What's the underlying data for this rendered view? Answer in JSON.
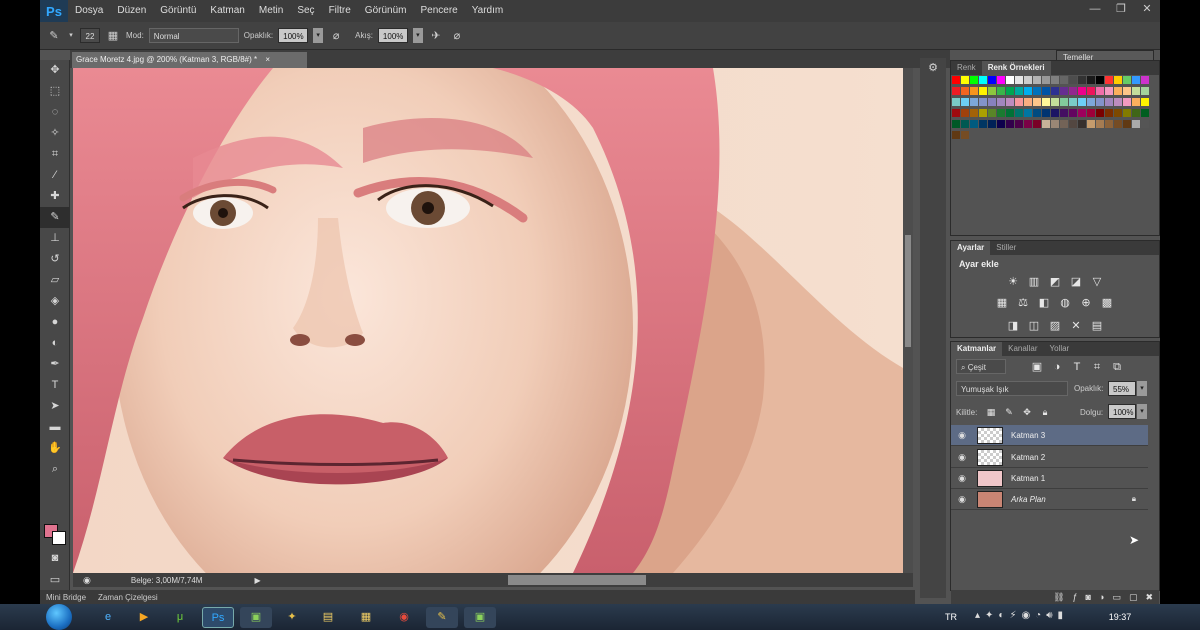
{
  "app": {
    "logo": "Ps",
    "menu": [
      "Dosya",
      "Düzen",
      "Görüntü",
      "Katman",
      "Metin",
      "Seç",
      "Filtre",
      "Görünüm",
      "Pencere",
      "Yardım"
    ],
    "window_buttons": [
      "—",
      "❐",
      "✕"
    ]
  },
  "options": {
    "brush_size": "22",
    "mode_label": "Mod:",
    "mode_value": "Normal",
    "opacity_label": "Opaklık:",
    "opacity_value": "100%",
    "flow_label": "Akış:",
    "flow_value": "100%",
    "workspace": "Temeller"
  },
  "document": {
    "tab_title": "Grace Moretz 4.jpg @ 200% (Katman 3, RGB/8#) *",
    "status": "Belge: 3,00M/7,74M"
  },
  "minibridge": {
    "tabs": [
      "Mini Bridge",
      "Zaman Çizelgesi"
    ]
  },
  "panels": {
    "color_tabs": [
      "Renk",
      "Renk Örnekleri"
    ],
    "adjust_tabs": [
      "Ayarlar",
      "Stiller"
    ],
    "adjust_title": "Ayar ekle",
    "layers_tabs": [
      "Katmanlar",
      "Kanallar",
      "Yollar"
    ],
    "filter_label": "Çeşit",
    "blend_mode": "Yumuşak Işık",
    "opacity_label": "Opaklık:",
    "opacity_value": "55%",
    "lock_label": "Kilitle:",
    "fill_label": "Dolgu:",
    "fill_value": "100%",
    "layers": [
      {
        "name": "Katman 3",
        "selected": true
      },
      {
        "name": "Katman 2",
        "selected": false
      },
      {
        "name": "Katman 1",
        "selected": false
      },
      {
        "name": "Arka Plan",
        "selected": false
      }
    ]
  },
  "colors": {
    "foreground": "#e0738f",
    "background": "#ffffff",
    "selection": "#5d6b85"
  },
  "taskbar": {
    "lang": "TR",
    "clock": "19:37"
  }
}
